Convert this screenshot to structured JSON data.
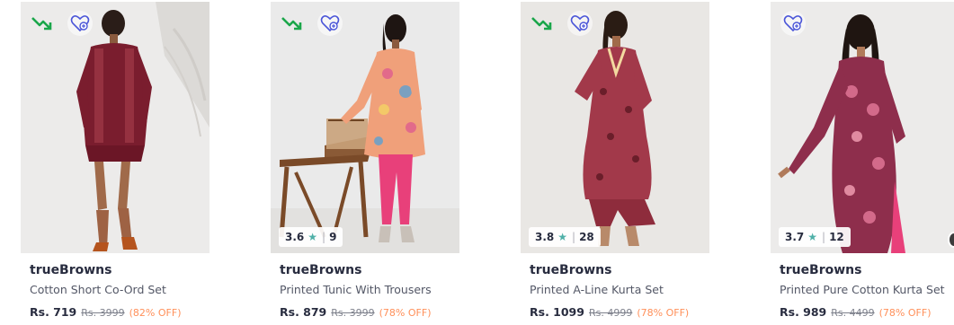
{
  "colors": {
    "trend": "#1aa64a",
    "wishlist": "#4a55d8",
    "rating_star": "#4fb0a8",
    "discount": "#ff905a",
    "brand_text": "#282c3f"
  },
  "products": [
    {
      "brand": "trueBrowns",
      "name": "Cotton Short Co-Ord Set",
      "price": "Rs. 719",
      "mrp": "Rs. 3999",
      "discount": "(82% OFF)",
      "trending": true
    },
    {
      "brand": "trueBrowns",
      "name": "Printed Tunic With Trousers",
      "price": "Rs. 879",
      "mrp": "Rs. 3999",
      "discount": "(78% OFF)",
      "trending": true,
      "rating": "3.6",
      "rating_count": "9"
    },
    {
      "brand": "trueBrowns",
      "name": "Printed A-Line Kurta Set",
      "price": "Rs. 1099",
      "mrp": "Rs. 4999",
      "discount": "(78% OFF)",
      "trending": true,
      "rating": "3.8",
      "rating_count": "28"
    },
    {
      "brand": "trueBrowns",
      "name": "Printed Pure Cotton Kurta Set",
      "price": "Rs. 989",
      "mrp": "Rs. 4499",
      "discount": "(78% OFF)",
      "trending": false,
      "rating": "3.7",
      "rating_count": "12"
    }
  ],
  "icons": {
    "trend": "trend-down-icon",
    "wishlist": "heart-plus-icon",
    "rating": "star-icon"
  }
}
